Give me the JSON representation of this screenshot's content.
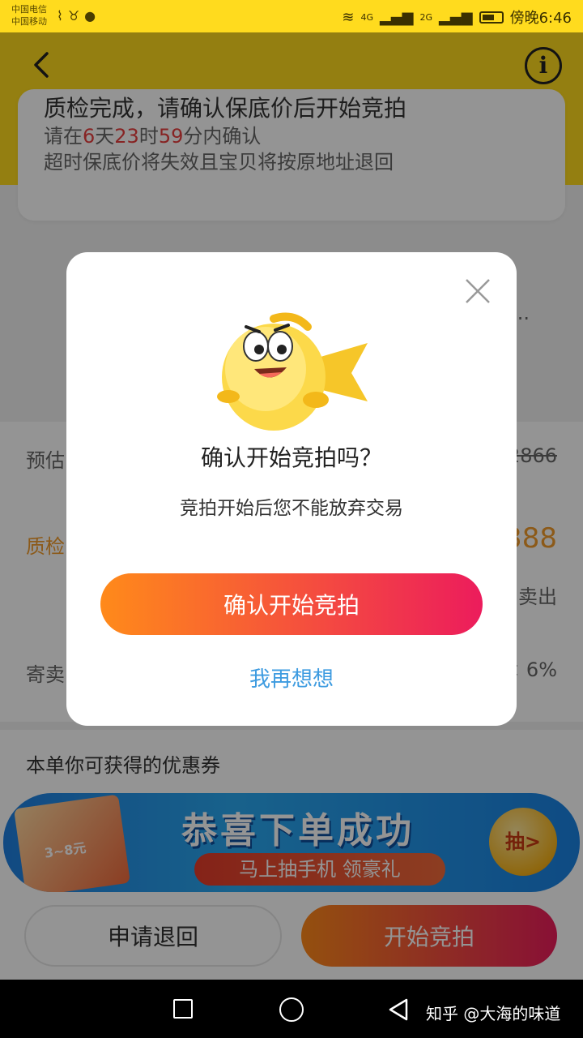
{
  "status_bar": {
    "carrier_1": "中国电信",
    "carrier_2": "中国移动",
    "signal_4g": "4G",
    "signal_2g": "2G",
    "time": "傍晚6:46"
  },
  "notice": {
    "title": "质检完成，请确认保底价后开始竞拍",
    "deadline_prefix": "请在",
    "days": "6",
    "days_unit": "天",
    "hours": "23",
    "hours_unit": "时",
    "minutes": "59",
    "minutes_unit": "分内确认",
    "line2": "超时保底价将失效且宝贝将按原地址退回"
  },
  "background_rows": {
    "ellipsis": "...",
    "estimate_label": "预估",
    "estimate_value": "2866",
    "inspect_label": "质检",
    "inspect_value": "388",
    "inspect_sub": "卖出",
    "consign_label": "寄卖",
    "consign_value": "× 6%"
  },
  "coupon": {
    "title": "本单你可获得的优惠券",
    "banner_headline": "恭喜下单成功",
    "banner_pill": "马上抽手机 领豪礼",
    "banner_badge": "抽>",
    "card_text": "3~8元"
  },
  "actions": {
    "return_label": "申请退回",
    "start_label": "开始竞拍"
  },
  "modal": {
    "title": "确认开始竞拍吗？",
    "subtitle": "竞拍开始后您不能放弃交易",
    "confirm_label": "确认开始竞拍",
    "cancel_label": "我再想想"
  },
  "watermark": "知乎 @大海的味道",
  "colors": {
    "header_yellow": "#FFDB1E",
    "accent_orange": "#FF8A1A",
    "accent_pink": "#EC1C5C",
    "countdown_red": "#E83E3E",
    "link_blue": "#3D9BE0"
  }
}
